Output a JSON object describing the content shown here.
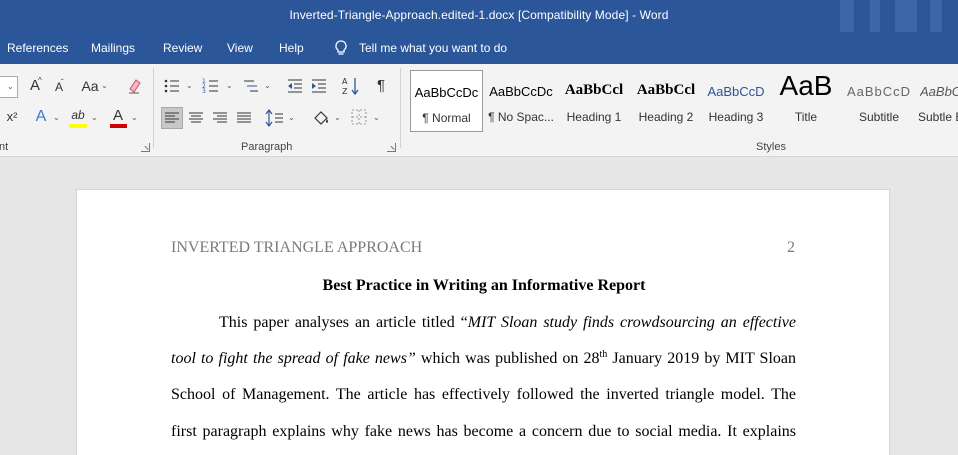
{
  "window": {
    "title": "Inverted-Triangle-Approach.edited-1.docx [Compatibility Mode]  -  Word"
  },
  "ribbon_tabs": [
    {
      "label": "References"
    },
    {
      "label": "Mailings"
    },
    {
      "label": "Review"
    },
    {
      "label": "View"
    },
    {
      "label": "Help"
    }
  ],
  "tell_me": {
    "text": "Tell me what you want to do",
    "icon": "lightbulb-icon"
  },
  "ribbon_groups": {
    "font_label_partial": "nt",
    "paragraph_label": "Paragraph",
    "styles_label": "Styles"
  },
  "font_tools": {
    "grow": "A",
    "shrink": "A",
    "case": "Aa",
    "superscript": "x²",
    "effects": "A",
    "font_color": "A",
    "highlight": "ab"
  },
  "paragraph_tools": {
    "pilcrow": "¶"
  },
  "styles": [
    {
      "sample": "AaBbCcDc",
      "name": "¶ Normal",
      "selected": true
    },
    {
      "sample": "AaBbCcDc",
      "name": "¶ No Spac..."
    },
    {
      "sample": "AaBbCcl",
      "name": "Heading 1"
    },
    {
      "sample": "AaBbCcl",
      "name": "Heading 2"
    },
    {
      "sample": "AaBbCcD",
      "name": "Heading 3"
    },
    {
      "sample": "AaB",
      "name": "Title"
    },
    {
      "sample": "AaBbCcD",
      "name": "Subtitle"
    },
    {
      "sample": "AaBbCcl",
      "name": "Subtle E"
    }
  ],
  "colors": {
    "titlebar": "#2b579a",
    "ribbon": "#f3f3f3",
    "heading_blue": "#2f5496",
    "font_color_bar": "#d00000",
    "highlight_bar": "#ffff00"
  },
  "document": {
    "running_head": "INVERTED TRIANGLE APPROACH",
    "page_number": "2",
    "title": "Best Practice in Writing an Informative Report",
    "lines": {
      "l1_pre": "This paper analyses an article titled “",
      "l1_italic": "MIT Sloan study finds crowdsourcing an effective",
      "l2_italic": "tool to fight the spread of fake news”",
      "l2_mid": " which was published on 28",
      "l2_sup": "th",
      "l2_post": " January 2019 by MIT Sloan",
      "l3": "School of Management. The article has effectively followed the inverted triangle model. The",
      "l4": "first paragraph explains why fake news has become a concern due to social media. It explains"
    }
  }
}
